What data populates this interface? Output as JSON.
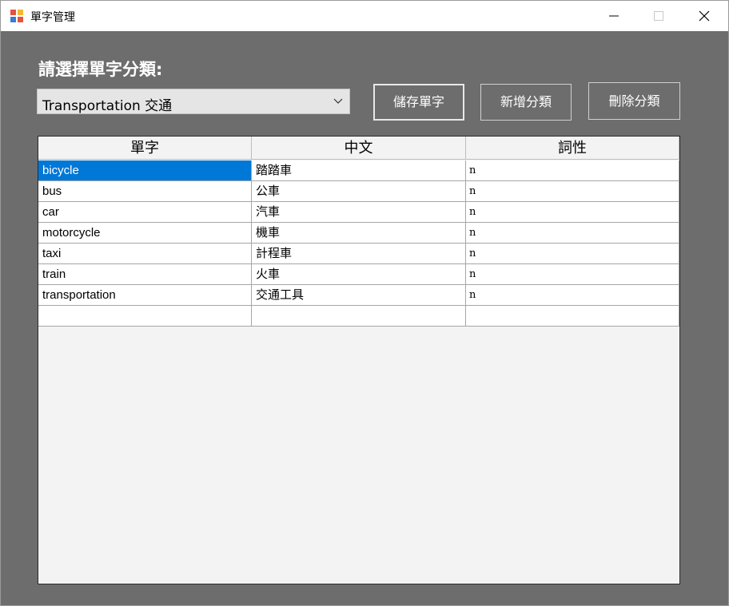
{
  "window": {
    "title": "單字管理",
    "minimize_symbol": "—",
    "maximize_symbol": "□",
    "close_symbol": "✕"
  },
  "category": {
    "label": "請選擇單字分類:",
    "selected": "Transportation 交通"
  },
  "buttons": {
    "save": "儲存單字",
    "add_category": "新增分類",
    "delete_category": "刪除分類"
  },
  "grid": {
    "columns": [
      "單字",
      "中文",
      "詞性"
    ],
    "rows": [
      [
        "bicycle",
        "踏踏車",
        "n"
      ],
      [
        "bus",
        "公車",
        "n"
      ],
      [
        "car",
        "汽車",
        "n"
      ],
      [
        "motorcycle",
        "機車",
        "n"
      ],
      [
        "taxi",
        "計程車",
        "n"
      ],
      [
        "train",
        "火車",
        "n"
      ],
      [
        "transportation",
        "交通工具",
        "n"
      ],
      [
        "",
        "",
        ""
      ]
    ],
    "selected_row": 0,
    "selected_col": 0
  },
  "colors": {
    "background": "#6d6d6d",
    "selection": "#0078d7",
    "grid_background": "#f3f3f3"
  }
}
